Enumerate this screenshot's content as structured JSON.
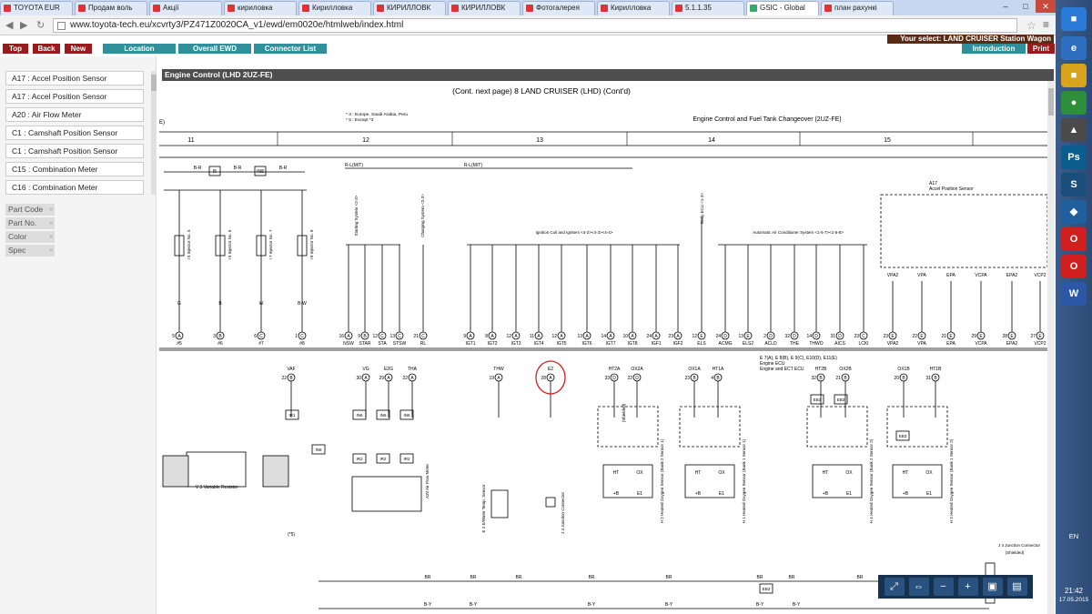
{
  "browser": {
    "tabs": [
      "TOYOTA EUR",
      "Продам воль",
      "Акції",
      "кириловка",
      "Кирилловка",
      "КИРИЛЛОВК",
      "КИРИЛЛОВК",
      "Фотогалерея",
      "Кирилловка",
      "5.1.1.35",
      "GSIC - Global",
      "план рахункі"
    ],
    "active_tab": "GSIC - Global",
    "url": "www.toyota-tech.eu/xcvrty3/PZ471Z0020CA_v1/ewd/em0020e/htmlweb/index.html"
  },
  "toolbar": {
    "top": "Top",
    "back": "Back",
    "new": "New",
    "location": "Location",
    "overall_ewd": "Overall EWD",
    "connector_list": "Connector List",
    "introduction": "Introduction",
    "print": "Print",
    "selection": "Your select: LAND CRUISER Station Wagon"
  },
  "sidebar": {
    "items": [
      "A17 : Accel Position Sensor",
      "A17 : Accel Position Sensor",
      "A20 : Air Flow Meter",
      "C1 : Camshaft Position Sensor",
      "C1 : Camshaft Position Sensor",
      "C15 : Combination Meter",
      "C16 : Combination Meter"
    ],
    "props": [
      "Part Code",
      "Part No.",
      "Color",
      "Spec"
    ]
  },
  "diagram": {
    "header": "Engine Control (LHD 2UZ-FE)",
    "caption": "(Cont.  next page) 8  LAND CRUISER (LHD) (Cont'd)",
    "notes": [
      "* 3 : Europe, Saudi Arabia, Peru",
      "* 5 : Except *3"
    ],
    "section_title": "Engine Control and Fuel Tank Changeover (2UZ-FE)",
    "columns": [
      "11",
      "12",
      "13",
      "14",
      "15"
    ],
    "labels": {
      "e_left": "E)",
      "rl_mt": "R-L(M/T)",
      "rl_mt2": "R-L(M/T)",
      "starting_system": "Starting System <2-3>",
      "charging_system": "Charging System <2-3>",
      "ignition": "Ignition Coil and Igniters <4-2><4-3><4-4>",
      "body_ecu": "Body ECU <1-3>",
      "ac_system": "Automatic Air Conditioner System <1-5-7><1-5-8>",
      "a17_title": "A17",
      "a17_name": "Accel Position Sensor",
      "ecu": "E 7(A), E 8(B), E 9(C), E10(D), E11(E)",
      "ecu2": "Engine ECU",
      "ecu3": "Engine and ECT ECU",
      "variable_resistor": "V 3  Variable Resistor",
      "air_flow": "A20 Air Flow Meter",
      "water_temp": "E 2 E/Water Temp. Sensor",
      "junction_j4": "J 4 Junction Connector",
      "junction_j4_r": "J 4 Junction Connector",
      "shielded": "(Shielded)",
      "shielded2": "(Shielded)"
    },
    "injectors": [
      {
        "label": "I 5 Injector No. 5",
        "pin": "5",
        "conn": "A",
        "name": "#5"
      },
      {
        "label": "I 6 Injector No. 6",
        "pin": "3",
        "conn": "B",
        "name": "#6"
      },
      {
        "label": "I 7 Injector No. 7",
        "pin": "6",
        "conn": "C",
        "name": "#7"
      },
      {
        "label": "I 8 Injector No. 8",
        "pin": "1",
        "conn": "C",
        "name": "#8"
      }
    ],
    "wire_colors": [
      "B-R",
      "B-R",
      "B-R",
      "B-R",
      "G",
      "B",
      "W",
      "B-W",
      "B-R",
      "B-R"
    ],
    "mid_pins": [
      {
        "pin": "16",
        "conn": "A",
        "name": "NSW"
      },
      {
        "pin": "9",
        "conn": "B",
        "name": "STAR"
      },
      {
        "pin": "12",
        "conn": "C",
        "name": "STA"
      },
      {
        "pin": "13",
        "conn": "C",
        "name": "STSW"
      },
      {
        "pin": "21",
        "conn": "C",
        "name": "RL"
      }
    ],
    "ign_pins": [
      {
        "pin": "9",
        "conn": "A",
        "name": "IGT1"
      },
      {
        "pin": "8",
        "conn": "A",
        "name": "IGT2"
      },
      {
        "pin": "12",
        "conn": "A",
        "name": "IGT3"
      },
      {
        "pin": "11",
        "conn": "A",
        "name": "IGT4"
      },
      {
        "pin": "12",
        "conn": "A",
        "name": "IGT5"
      },
      {
        "pin": "13",
        "conn": "A",
        "name": "IGT6"
      },
      {
        "pin": "14",
        "conn": "A",
        "name": "IGT7"
      },
      {
        "pin": "10",
        "conn": "A",
        "name": "IGT8"
      },
      {
        "pin": "24",
        "conn": "A",
        "name": "IGF1"
      },
      {
        "pin": "23",
        "conn": "A",
        "name": "IGF2"
      }
    ],
    "right_pins": [
      {
        "pin": "12",
        "conn": "E",
        "name": "ELS"
      },
      {
        "pin": "24",
        "conn": "D",
        "name": "ACMG"
      },
      {
        "pin": "13",
        "conn": "E",
        "name": "ELS2"
      },
      {
        "pin": "2",
        "conn": "D",
        "name": "ACLD"
      },
      {
        "pin": "32",
        "conn": "D",
        "name": "THE"
      },
      {
        "pin": "14",
        "conn": "D",
        "name": "THWO"
      },
      {
        "pin": "31",
        "conn": "D",
        "name": "AICS"
      },
      {
        "pin": "23",
        "conn": "C",
        "name": "LCKI"
      }
    ],
    "vpa_pins": [
      {
        "pin": "23",
        "conn": "E",
        "name": "VPA2"
      },
      {
        "pin": "22",
        "conn": "E",
        "name": "VPA"
      },
      {
        "pin": "21",
        "conn": "E",
        "name": "EPA"
      },
      {
        "pin": "29",
        "conn": "E",
        "name": "VCPA"
      },
      {
        "pin": "28",
        "conn": "E",
        "name": "EPA2"
      },
      {
        "pin": "27",
        "conn": "E",
        "name": "VCP2"
      }
    ],
    "lower_pins": [
      {
        "pin": "22",
        "conn": "B",
        "name": "VAF"
      },
      {
        "pin": "30",
        "conn": "A",
        "name": "VG"
      },
      {
        "pin": "29",
        "conn": "A",
        "name": "E2G"
      },
      {
        "pin": "22",
        "conn": "A",
        "name": "THA"
      },
      {
        "pin": "19",
        "conn": "A",
        "name": "THW"
      },
      {
        "pin": "28",
        "conn": "A",
        "name": "E2"
      },
      {
        "pin": "33",
        "conn": "D",
        "name": "HT2A"
      },
      {
        "pin": "22",
        "conn": "D",
        "name": "OX2A"
      },
      {
        "pin": "23",
        "conn": "B",
        "name": "OX1A"
      },
      {
        "pin": "4",
        "conn": "B",
        "name": "HT1A"
      },
      {
        "pin": "32",
        "conn": "B",
        "name": "HT2B"
      },
      {
        "pin": "21",
        "conn": "B",
        "name": "OX2B"
      },
      {
        "pin": "20",
        "conn": "B",
        "name": "OX1B"
      },
      {
        "pin": "31",
        "conn": "B",
        "name": "HT1B"
      }
    ],
    "sensors": [
      {
        "label": "H 2 Heated Oxygen Sensor (Bank 2 Sensor 1)"
      },
      {
        "label": "H 1 Heated Oxygen Sensor (Bank 1 Sensor 1)"
      },
      {
        "label": "H 4 Heated Oxygen Sensor (Bank 2 Sensor 2)"
      },
      {
        "label": "H 3 Heated Oxygen Sensor (Bank 1 Sensor 2)"
      }
    ],
    "connectors": [
      "IR1",
      "IN6",
      "IN6",
      "IN6",
      "IR2",
      "IR2",
      "IR2",
      "IN6",
      "EB3",
      "EB3",
      "EB3",
      "EB3",
      "EB1"
    ],
    "bus_labels": [
      "BR",
      "BR",
      "BR",
      "BR",
      "BR",
      "BR",
      "BR",
      "BR",
      "B-Y",
      "B-Y",
      "B-Y",
      "B-Y",
      "B-Y",
      "B-Y"
    ],
    "bottom_notes": [
      "(*5)",
      "(*3)",
      "(*5)",
      "(*3)",
      "(*3)"
    ],
    "sensor_pins": [
      "HT",
      "OX",
      "+B",
      "E1"
    ]
  },
  "viewtools": [
    "fit-icon",
    "pan-icon",
    "zoom-out-icon",
    "zoom-in-icon",
    "save-icon",
    "print-icon"
  ],
  "taskbar": {
    "lang": "EN",
    "time": "21:42",
    "date": "17.05.2015"
  }
}
